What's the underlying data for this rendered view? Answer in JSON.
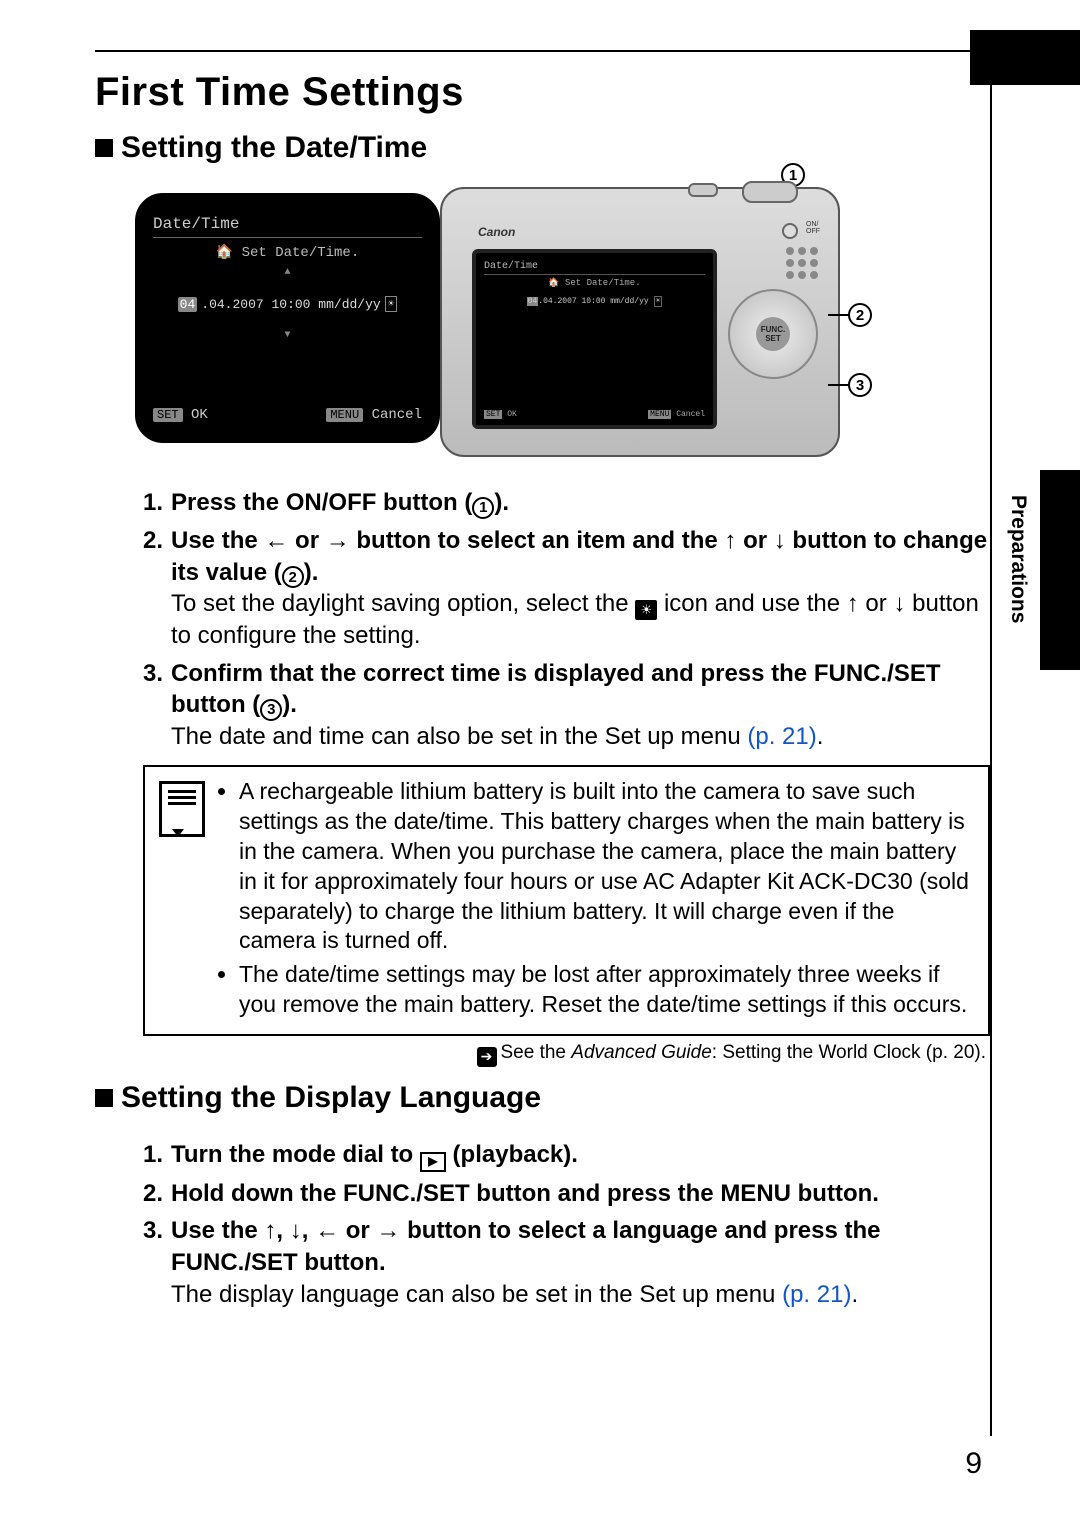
{
  "page_number": "9",
  "side_tab_label": "Preparations",
  "title": "First Time Settings",
  "section1_title": "Setting the Date/Time",
  "screen": {
    "title": "Date/Time",
    "subtitle": "Set Date/Time.",
    "hl": "04",
    "rest": ".04.2007 10:00 mm/dd/yy",
    "set": "SET",
    "ok": "OK",
    "menu": "MENU",
    "cancel": "Cancel"
  },
  "camera_brand": "Canon",
  "func_label": "FUNC.\nSET",
  "on_off_label": "ON/\nOFF",
  "callout": {
    "c1": "1",
    "c2": "2",
    "c3": "3"
  },
  "steps_a": {
    "s1": {
      "b": "Press the ON/OFF button (",
      "c": "1",
      "e": ")."
    },
    "s2": {
      "b1": "Use the ",
      "a1": "←",
      "or1": " or ",
      "a2": "→",
      "b2": " button to select an item and the ",
      "a3": "↑",
      "or2": " or ",
      "a4": "↓",
      "b3": " button to change its value (",
      "c": "2",
      "e": ").",
      "body1": "To set the daylight saving option, select the ",
      "body2": " icon and use the ",
      "a5": "↑",
      "or3": " or ",
      "a6": "↓",
      "body3": " button to configure the setting."
    },
    "s3": {
      "b": "Confirm that the correct time is displayed and press the FUNC./SET button (",
      "c": "3",
      "e": ").",
      "body": "The date and time can also be set in the Set up menu ",
      "link": "(p. 21)",
      "dot": "."
    }
  },
  "note": {
    "n1": "A rechargeable lithium battery is built into the camera to save such settings as the date/time. This battery charges when the main battery is in the camera. When you purchase the camera, place the main battery in it for approximately four hours or use AC Adapter Kit ACK-DC30 (sold separately) to charge the lithium battery. It will charge even if the camera is turned off.",
    "n2": "The date/time settings may be lost after approximately three weeks if you remove the main battery. Reset the date/time settings if this occurs."
  },
  "see_also": {
    "pre": "See the ",
    "ital": "Advanced Guide",
    "post": ": Setting the World Clock (p. 20)."
  },
  "section2_title": "Setting the Display Language",
  "steps_b": {
    "s1": {
      "b1": "Turn the mode dial to ",
      "b2": " (playback)."
    },
    "s2": {
      "b": "Hold down the FUNC./SET button and press the MENU button."
    },
    "s3": {
      "b1": "Use the ",
      "a1": "↑",
      "com1": ", ",
      "a2": "↓",
      "com2": ", ",
      "a3": "←",
      "or": " or ",
      "a4": "→",
      "b2": " button to select a language and press the FUNC./SET button.",
      "body": "The display language can also be set in the Set up menu ",
      "link": "(p. 21)",
      "dot": "."
    }
  },
  "dst": "☀"
}
